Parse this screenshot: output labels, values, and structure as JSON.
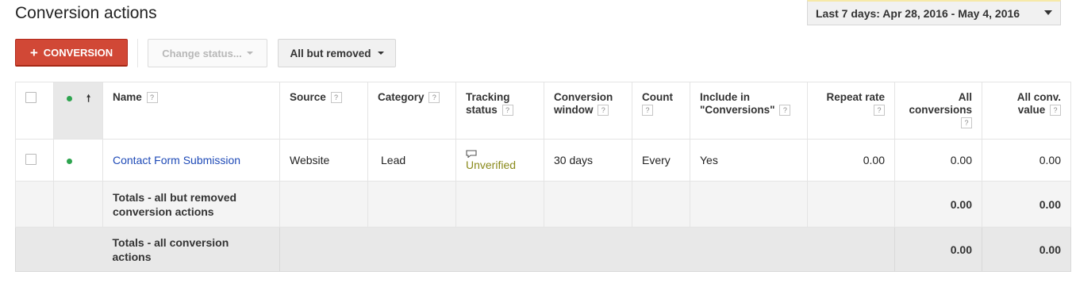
{
  "page": {
    "title": "Conversion actions",
    "date_range": "Last 7 days: Apr 28, 2016 - May 4, 2016"
  },
  "toolbar": {
    "conversion_button": "CONVERSION",
    "change_status": "Change status...",
    "filter": "All but removed"
  },
  "table": {
    "columns": {
      "name": "Name",
      "source": "Source",
      "category": "Category",
      "tracking_status": "Tracking status",
      "conversion_window": "Conversion window",
      "count": "Count",
      "include_in_conversions": "Include in \"Conversions\"",
      "repeat_rate": "Repeat rate",
      "all_conversions": "All conversions",
      "all_conv_value": "All conv. value"
    },
    "help_glyph": "?",
    "rows": [
      {
        "name": "Contact Form Submission",
        "source": "Website",
        "category": "Lead",
        "tracking_status": "Unverified",
        "conversion_window": "30 days",
        "count": "Every",
        "include_in_conversions": "Yes",
        "repeat_rate": "0.00",
        "all_conversions": "0.00",
        "all_conv_value": "0.00"
      }
    ],
    "totals_removed": {
      "label": "Totals - all but removed conversion actions",
      "all_conversions": "0.00",
      "all_conv_value": "0.00"
    },
    "totals_all": {
      "label": "Totals - all conversion actions",
      "all_conversions": "0.00",
      "all_conv_value": "0.00"
    }
  },
  "colors": {
    "primary_button": "#d14836",
    "link": "#1e4ab7",
    "status_enabled": "#2ea44f",
    "unverified": "#8a8a1b"
  },
  "icons": [
    "plus-icon",
    "caret-down-icon",
    "sort-up-icon",
    "status-dot-icon",
    "comment-icon",
    "help-icon"
  ]
}
